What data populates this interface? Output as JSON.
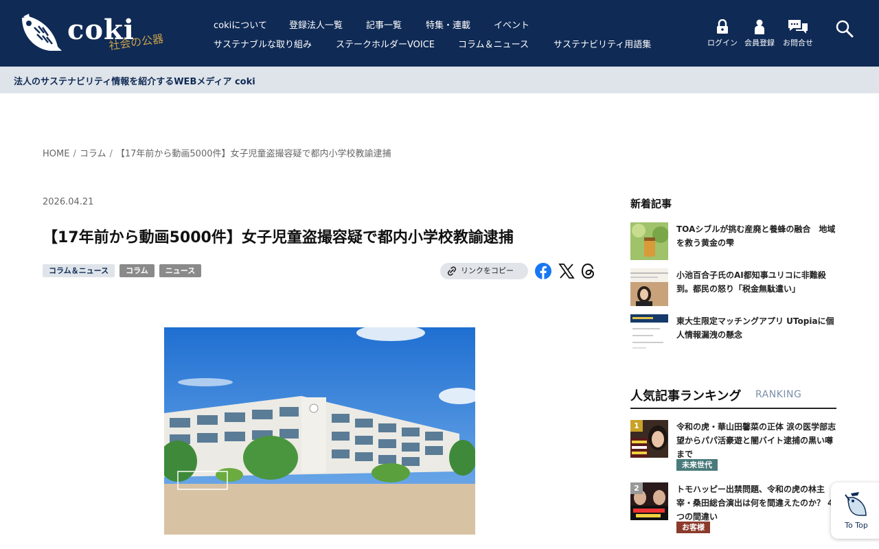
{
  "header": {
    "logo_text": "coki",
    "logo_sub": "社会の公器",
    "nav_row1": [
      "cokiについて",
      "登録法人一覧",
      "記事一覧",
      "特集・連載",
      "イベント"
    ],
    "nav_row2": [
      "サステナブルな取り組み",
      "ステークホルダーVOICE",
      "コラム＆ニュース",
      "サステナビリティ用語集"
    ],
    "login": "ログイン",
    "register": "会員登録",
    "contact": "お問合せ"
  },
  "tagline": "法人のサステナビリティ情報を紹介するWEBメディア coki",
  "breadcrumb": {
    "home": "HOME",
    "column": "コラム",
    "current": "【17年前から動画5000件】女子児童盗撮容疑で都内小学校教諭逮捕"
  },
  "article": {
    "date": "2026.04.21",
    "title": "【17年前から動画5000件】女子児童盗撮容疑で都内小学校教諭逮捕",
    "tags": [
      "コラム＆ニュース",
      "コラム",
      "ニュース"
    ],
    "copy_link": "リンクをコピー"
  },
  "sidebar": {
    "new_title": "新着記事",
    "new_items": [
      "TOAシブルが挑む産廃と養蜂の融合　地域を救う黄金の雫",
      "小池百合子氏のAI都知事ユリコに非難殺到。都民の怒り「税金無駄遣い」",
      "東大生限定マッチングアプリ UTopiaに個人情報漏洩の懸念"
    ],
    "ranking_title": "人気記事ランキング",
    "ranking_en": "RANKING",
    "ranking": [
      {
        "rank": "1",
        "title": "令和の虎・華山田馨菜の正体 涙の医学部志望からパパ活豪遊と闇バイト逮捕の黒い噂まで",
        "badge": "未来世代"
      },
      {
        "rank": "2",
        "title": "トモハッピー出禁問題、令和の虎の林主宰・桑田総合演出は何を間違えたのか？ 4つの間違い",
        "badge": "お客様"
      }
    ]
  },
  "totop": "To Top",
  "colors": {
    "navy": "#0f2a55",
    "badge_green": "#4a7a7a",
    "badge_red": "#8b3a2b",
    "gold": "#c9a227"
  }
}
